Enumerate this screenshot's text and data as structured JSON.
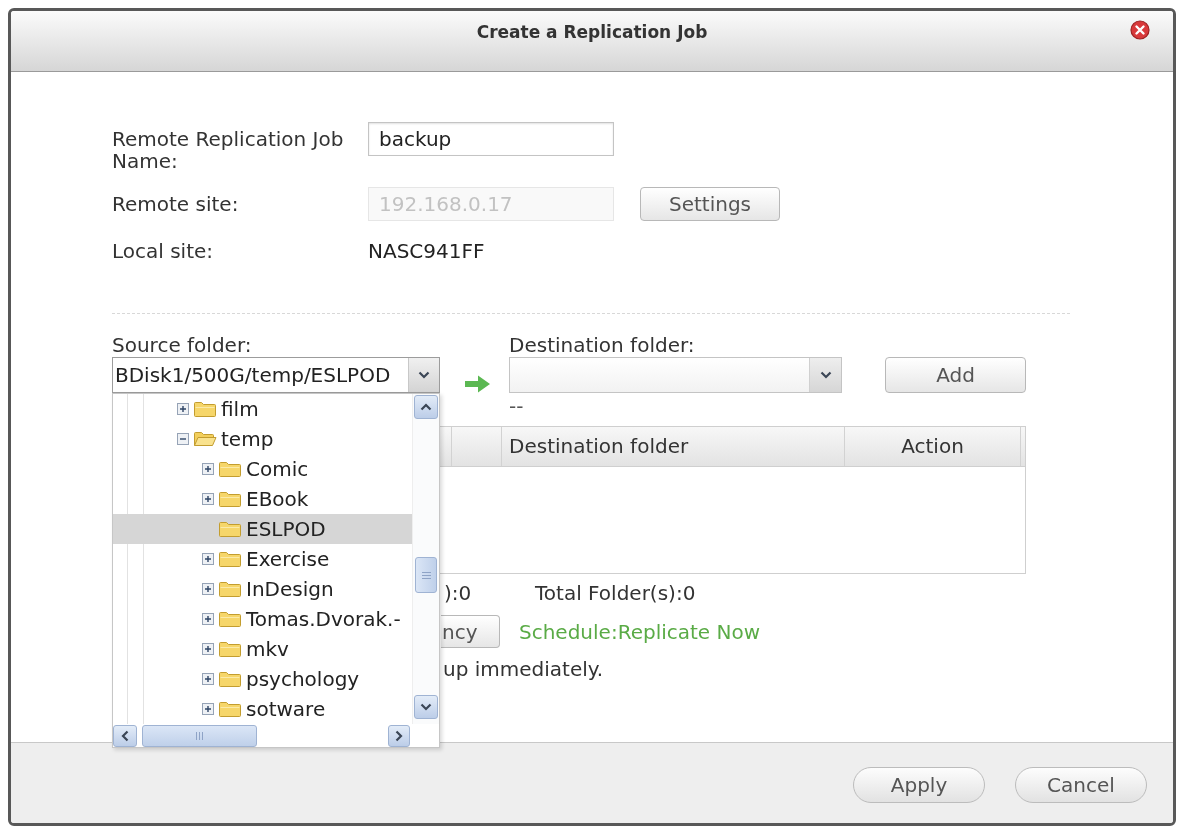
{
  "dialog": {
    "title": "Create a Replication Job"
  },
  "form": {
    "job_name": {
      "label": "Remote Replication Job Name:",
      "value": "backup"
    },
    "remote_site": {
      "label": "Remote site:",
      "value": "192.168.0.17",
      "disabled": true,
      "button": "Settings"
    },
    "local_site": {
      "label": "Local site:",
      "value": "NASC941FF"
    }
  },
  "source_folder": {
    "label": "Source folder:",
    "value": "BDisk1/500G/temp/ESLPOD",
    "open": true,
    "tree": [
      {
        "label": "film",
        "kind": "folder",
        "expanded": false,
        "selected": false
      },
      {
        "label": "temp",
        "kind": "folder",
        "expanded": true,
        "selected": false,
        "children": [
          {
            "label": "Comic",
            "kind": "folder",
            "expanded": false,
            "selected": false
          },
          {
            "label": "EBook",
            "kind": "folder",
            "expanded": false,
            "selected": false
          },
          {
            "label": "ESLPOD",
            "kind": "leaf",
            "selected": true
          },
          {
            "label": "Exercise",
            "kind": "folder",
            "expanded": false,
            "selected": false
          },
          {
            "label": "InDesign",
            "kind": "folder",
            "expanded": false,
            "selected": false
          },
          {
            "label": "Tomas.Dvorak.-",
            "kind": "folder",
            "expanded": false,
            "selected": false
          },
          {
            "label": "mkv",
            "kind": "folder",
            "expanded": false,
            "selected": false
          },
          {
            "label": "psychology",
            "kind": "folder",
            "expanded": false,
            "selected": false
          },
          {
            "label": "sotware",
            "kind": "folder",
            "expanded": false,
            "selected": false
          }
        ]
      }
    ]
  },
  "destination_folder": {
    "label": "Destination folder:",
    "path": "--",
    "button": "Add"
  },
  "table": {
    "columns": [
      "Destination folder",
      "Action"
    ]
  },
  "totals": [
    "):0",
    "Total Folder(s):0"
  ],
  "schedule": {
    "button": "ncy",
    "text": "Schedule:Replicate Now"
  },
  "note": "up immediately.",
  "footer": {
    "buttons": [
      "Apply",
      "Cancel"
    ]
  }
}
